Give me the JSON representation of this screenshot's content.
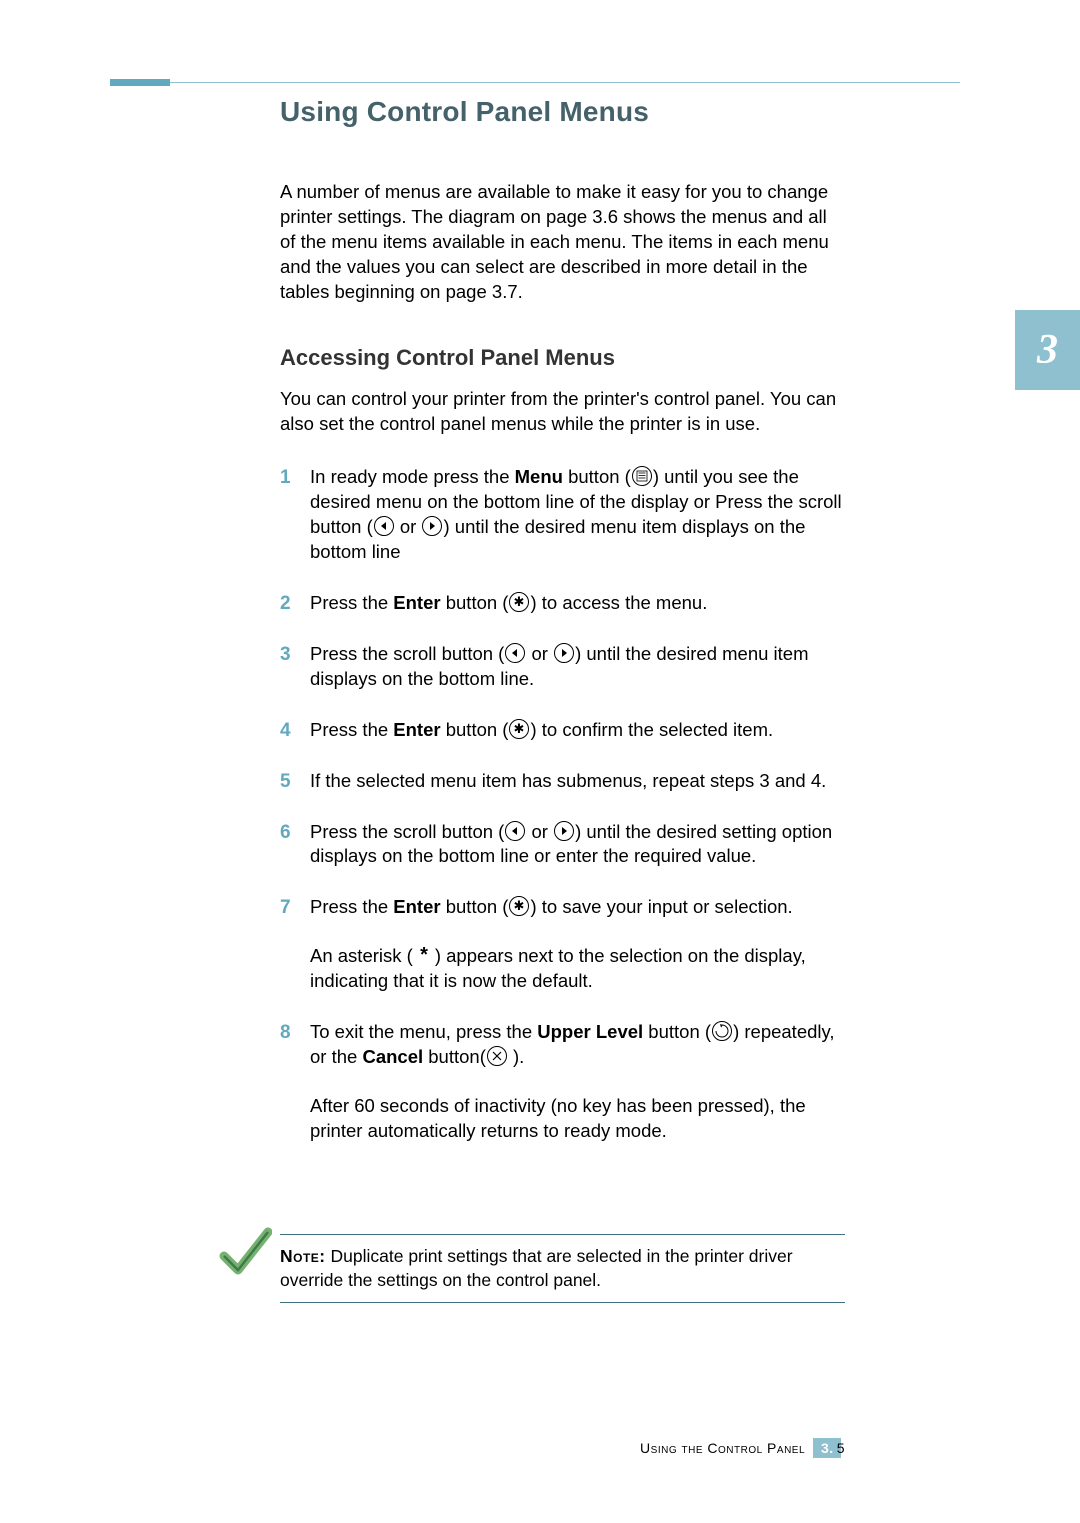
{
  "chapter_tab": "3",
  "title": "Using Control Panel Menus",
  "intro": "A number of menus are available to make it easy for you to change printer settings. The diagram on page 3.6 shows the menus and all of the menu items available in each menu. The items in each menu and the values you can select are described in more detail in the tables beginning on page 3.7.",
  "subhead": "Accessing Control Panel Menus",
  "lead": "You can control your printer from the printer's control panel. You can also set the control panel menus while the printer is in use.",
  "steps": [
    {
      "n": "1",
      "parts": [
        {
          "t": "In ready mode press the "
        },
        {
          "b": "Menu"
        },
        {
          "t": " button ("
        },
        {
          "icon": "menu-icon"
        },
        {
          "t": ") until you see the desired menu on the bottom line of the display or Press the scroll button ("
        },
        {
          "icon": "left-arrow-icon"
        },
        {
          "t": " or "
        },
        {
          "icon": "right-arrow-icon"
        },
        {
          "t": ") until the desired menu item displays on the bottom line"
        }
      ]
    },
    {
      "n": "2",
      "parts": [
        {
          "t": "Press the "
        },
        {
          "b": "Enter"
        },
        {
          "t": " button ("
        },
        {
          "icon": "enter-icon"
        },
        {
          "t": ") to access the menu."
        }
      ]
    },
    {
      "n": "3",
      "parts": [
        {
          "t": "Press the scroll button ("
        },
        {
          "icon": "left-arrow-icon"
        },
        {
          "t": " or "
        },
        {
          "icon": "right-arrow-icon"
        },
        {
          "t": ") until the desired menu item displays on the bottom line."
        }
      ]
    },
    {
      "n": "4",
      "parts": [
        {
          "t": "Press the "
        },
        {
          "b": "Enter"
        },
        {
          "t": " button ("
        },
        {
          "icon": "enter-icon"
        },
        {
          "t": ") to confirm the selected item."
        }
      ]
    },
    {
      "n": "5",
      "parts": [
        {
          "t": "If the selected menu item has submenus, repeat steps 3 and 4."
        }
      ]
    },
    {
      "n": "6",
      "parts": [
        {
          "t": "Press the scroll button ("
        },
        {
          "icon": "left-arrow-icon"
        },
        {
          "t": " or "
        },
        {
          "icon": "right-arrow-icon"
        },
        {
          "t": ") until the desired setting option displays on the bottom line or enter the required value."
        }
      ]
    },
    {
      "n": "7",
      "paras": [
        [
          {
            "t": "Press the "
          },
          {
            "b": "Enter"
          },
          {
            "t": " button ("
          },
          {
            "icon": "enter-icon"
          },
          {
            "t": ") to save your input or selection."
          }
        ],
        [
          {
            "t": "An asterisk ("
          },
          {
            "icon": "asterisk-icon"
          },
          {
            "t": ") appears next to the selection on the display, indicating that it is now the default."
          }
        ]
      ]
    },
    {
      "n": "8",
      "paras": [
        [
          {
            "t": "To exit the menu, press the "
          },
          {
            "b": "Upper Level"
          },
          {
            "t": " button ("
          },
          {
            "icon": "upper-level-icon"
          },
          {
            "t": ") repeatedly, or the "
          },
          {
            "b": "Cancel"
          },
          {
            "t": " button("
          },
          {
            "icon": "cancel-icon"
          },
          {
            "t": " )."
          }
        ],
        [
          {
            "t": "After 60 seconds of inactivity (no key has been pressed), the printer automatically returns to ready mode."
          }
        ]
      ]
    }
  ],
  "note_label": "Note:",
  "note_text": " Duplicate print settings that are selected in the printer driver override the settings on the control panel.",
  "footer_text": "Using the Control Panel",
  "footer_chapter": "3.",
  "footer_page": "5"
}
